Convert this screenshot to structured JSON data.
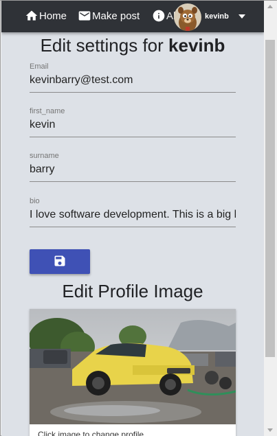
{
  "navbar": {
    "home_label": "Home",
    "post_label": "Make post",
    "about_label": "About",
    "user_name": "kevinb"
  },
  "page": {
    "title_prefix": "Edit settings for",
    "title_user": "kevinb"
  },
  "form": {
    "email": {
      "label": "Email",
      "value": "kevinbarry@test.com"
    },
    "first_name": {
      "label": "first_name",
      "value": "kevin"
    },
    "surname": {
      "label": "surname",
      "value": "barry"
    },
    "bio": {
      "label": "bio",
      "value": "I love software development. This is a big l"
    }
  },
  "profile_image": {
    "title": "Edit Profile Image",
    "caption": "Click image to change profile"
  },
  "colors": {
    "navbar": "#2f3237",
    "page_background": "#dde1e7",
    "save_button": "#3f51b5"
  },
  "icons": {
    "home": "home-icon",
    "post": "mail-icon",
    "about": "info-icon",
    "save": "floppy-disk-icon",
    "menu": "caret-down-icon"
  }
}
